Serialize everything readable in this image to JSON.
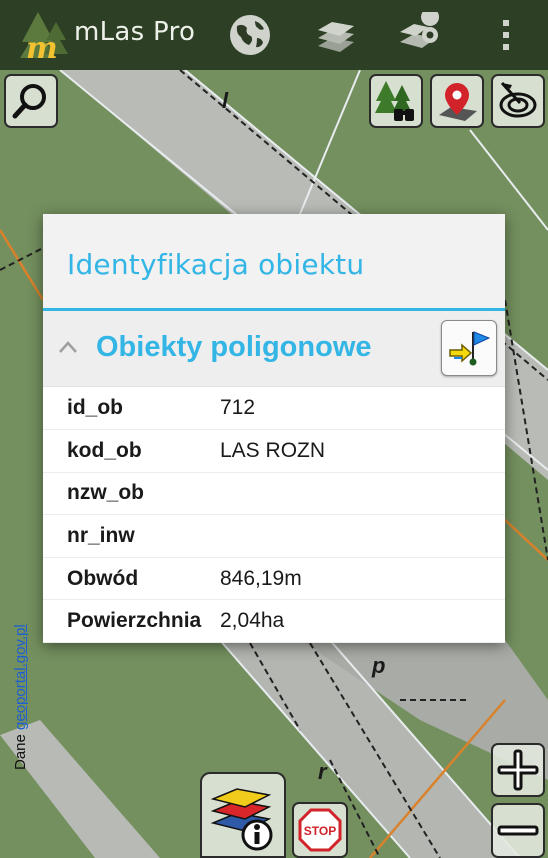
{
  "app": {
    "title": "mLas Pro",
    "accent_color": "#33b5e5",
    "toolbar_icons": [
      "globe-icon",
      "layers-icon",
      "map-pin-overlay-icon",
      "overflow-menu-icon"
    ]
  },
  "map": {
    "labels": [
      "l",
      "p",
      "r"
    ],
    "attribution_prefix": "Dane ",
    "attribution_link": "geoportal.gov.pl",
    "tool_icons": [
      "search-icon",
      "forest-binoculars-icon",
      "location-pin-icon",
      "gps-tracking-icon",
      "layers-info-icon",
      "stop-icon",
      "zoom-in-icon",
      "zoom-out-icon"
    ],
    "stop_label": "STOP"
  },
  "dialog": {
    "title": "Identyfikacja obiektu",
    "section_title": "Obiekty poligonowe",
    "section_action_icon": "flag-navigate-icon",
    "rows": [
      {
        "key": "id_ob",
        "value": "712"
      },
      {
        "key": "kod_ob",
        "value": "LAS ROZN"
      },
      {
        "key": "nzw_ob",
        "value": ""
      },
      {
        "key": "nr_inw",
        "value": ""
      },
      {
        "key": "Obwód",
        "value": "846,19m"
      },
      {
        "key": "Powierzchnia",
        "value": "2,04ha"
      }
    ]
  }
}
